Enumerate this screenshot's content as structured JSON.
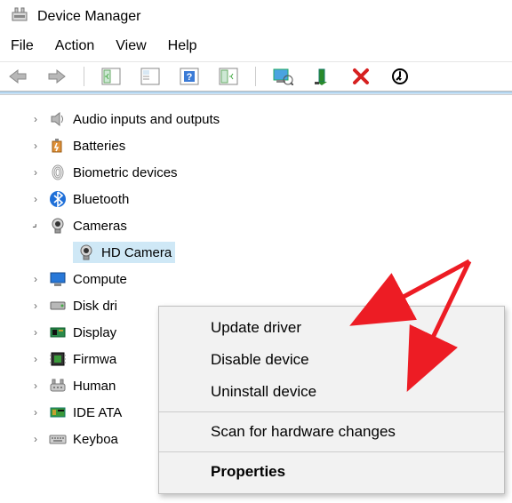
{
  "title": "Device Manager",
  "menubar": [
    "File",
    "Action",
    "View",
    "Help"
  ],
  "tree": [
    {
      "expand": ">",
      "icon": "speaker",
      "label": "Audio inputs and outputs"
    },
    {
      "expand": ">",
      "icon": "battery",
      "label": "Batteries"
    },
    {
      "expand": ">",
      "icon": "fingerprint",
      "label": "Biometric devices"
    },
    {
      "expand": ">",
      "icon": "bluetooth",
      "label": "Bluetooth"
    },
    {
      "expand": "v",
      "icon": "camera",
      "label": "Cameras",
      "children": [
        {
          "icon": "camera",
          "label": "HD Camera",
          "selected": true
        }
      ]
    },
    {
      "expand": ">",
      "icon": "monitor",
      "label": "Computers"
    },
    {
      "expand": ">",
      "icon": "disk",
      "label": "Disk drives"
    },
    {
      "expand": ">",
      "icon": "display-adapter",
      "label": "Display adapters"
    },
    {
      "expand": ">",
      "icon": "firmware",
      "label": "Firmware"
    },
    {
      "expand": ">",
      "icon": "hid",
      "label": "Human Interface Devices"
    },
    {
      "expand": ">",
      "icon": "ide",
      "label": "IDE ATA/ATAPI controllers"
    },
    {
      "expand": ">",
      "icon": "keyboard",
      "label": "Keyboards"
    }
  ],
  "context_menu": {
    "items": [
      {
        "label": "Update driver"
      },
      {
        "label": "Disable device"
      },
      {
        "label": "Uninstall device"
      },
      {
        "sep": true
      },
      {
        "label": "Scan for hardware changes"
      },
      {
        "sep": true
      },
      {
        "label": "Properties",
        "bold": true
      }
    ]
  },
  "truncated_labels": {
    "computers": "Compute",
    "disk": "Disk dri",
    "display": "Display",
    "firmware": "Firmwa",
    "hid": "Human",
    "ide": "IDE ATA",
    "keyboard": "Keyboa"
  }
}
